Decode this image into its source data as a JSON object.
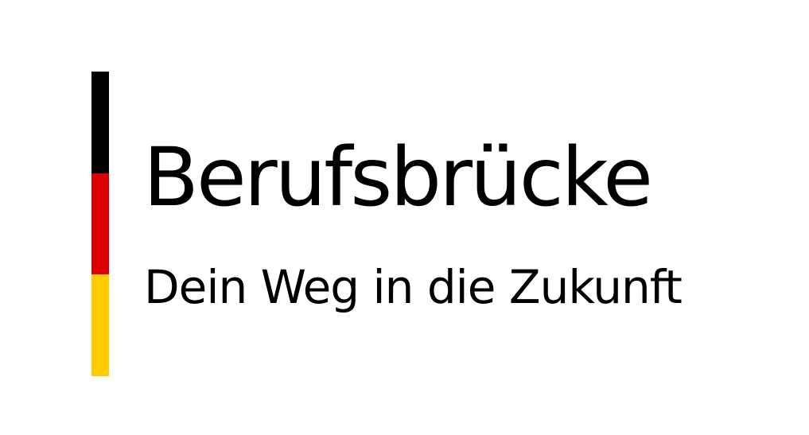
{
  "logo": {
    "title": "Berufsbrücke",
    "tagline": "Dein Weg in die Zukunft",
    "flag_colors": [
      "#000000",
      "#dd0000",
      "#ffcc00"
    ],
    "text_color": "#000000",
    "background": "#ffffff"
  }
}
